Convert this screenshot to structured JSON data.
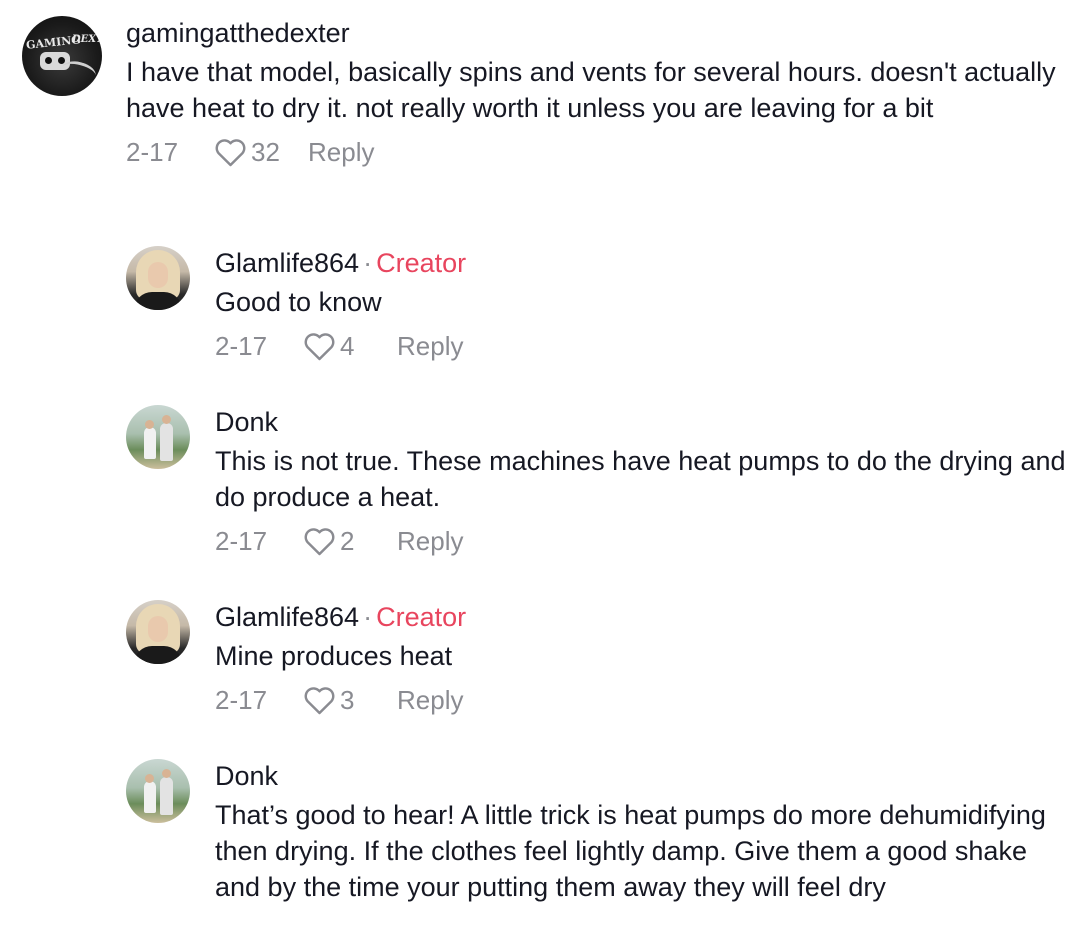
{
  "comments": [
    {
      "username": "gamingatthedexter",
      "avatar_text_1": "GAMING",
      "avatar_text_2": "DEXTE",
      "text": "I have that model, basically spins and vents for several hours. doesn't actually have heat to dry it. not really worth it unless you are leaving for a bit",
      "date": "2-17",
      "likes": "32",
      "reply_label": "Reply"
    },
    {
      "username": "Glamlife864",
      "separator": "·",
      "badge": "Creator",
      "text": "Good to know",
      "date": "2-17",
      "likes": "4",
      "reply_label": "Reply"
    },
    {
      "username": "Donk",
      "text": "This is not true. These machines have heat pumps to do the drying and do produce a heat.",
      "date": "2-17",
      "likes": "2",
      "reply_label": "Reply"
    },
    {
      "username": "Glamlife864",
      "separator": "·",
      "badge": "Creator",
      "text": "Mine produces heat",
      "date": "2-17",
      "likes": "3",
      "reply_label": "Reply"
    },
    {
      "username": "Donk",
      "text": "That’s good to hear! A little trick is heat pumps do more dehumidifying then drying. If the clothes feel lightly damp. Give them a good shake and by the time your putting them away they will feel dry"
    }
  ],
  "colors": {
    "text": "#161823",
    "secondary": "#8a8b91",
    "creator": "#e8455e"
  },
  "icons": {
    "like": "heart-outline-icon"
  }
}
